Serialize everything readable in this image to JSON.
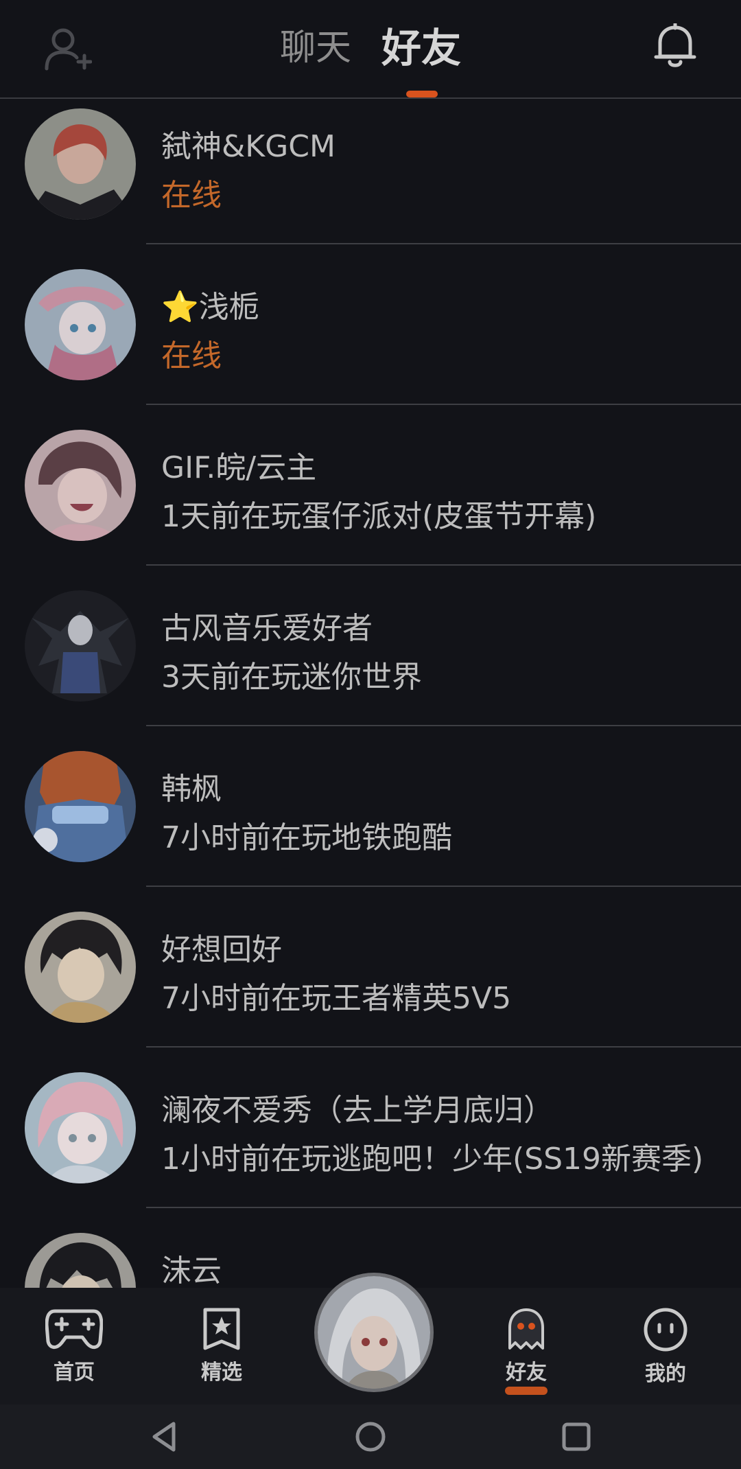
{
  "header": {
    "tabs": [
      {
        "label": "聊天"
      },
      {
        "label": "好友"
      }
    ],
    "active_tab": "好友",
    "add_friend_icon": "add-user-icon",
    "notification_icon": "bell-icon",
    "accent_color": "#d9531e"
  },
  "friends": [
    {
      "name": "弑神&KGCM",
      "status": "在线",
      "online": true
    },
    {
      "name": "⭐浅栀",
      "status": "在线",
      "online": true
    },
    {
      "name": "GIF.皖/云主",
      "status": "1天前在玩蛋仔派对(皮蛋节开幕)",
      "online": false
    },
    {
      "name": "古风音乐爱好者",
      "status": "3天前在玩迷你世界",
      "online": false
    },
    {
      "name": "韩枫",
      "status": "7小时前在玩地铁跑酷",
      "online": false
    },
    {
      "name": "好想回好",
      "status": "7小时前在玩王者精英5V5",
      "online": false
    },
    {
      "name": "澜夜不爱秀（去上学月底归）",
      "status": "1小时前在玩逃跑吧！少年(SS19新赛季)",
      "online": false
    },
    {
      "name": "沫云",
      "status": "",
      "online": false
    }
  ],
  "bottom_nav": {
    "items": [
      {
        "label": "首页",
        "icon": "gamepad-icon"
      },
      {
        "label": "精选",
        "icon": "star-bookmark-icon"
      },
      {
        "label": "好友",
        "icon": "ghost-icon"
      },
      {
        "label": "我的",
        "icon": "smiley-icon"
      }
    ],
    "active": "好友"
  },
  "system_bar": {
    "buttons": [
      "back-icon",
      "home-icon",
      "recents-icon"
    ]
  }
}
